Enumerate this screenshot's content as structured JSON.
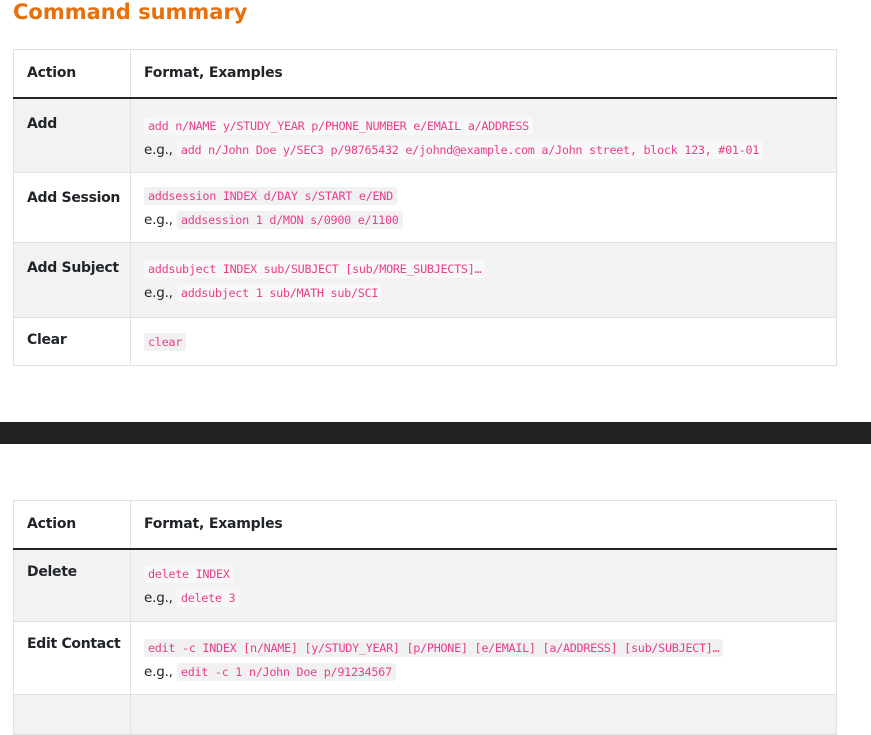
{
  "page": {
    "title": "Command summary",
    "accent_color": "#e76f0c",
    "code_color": "#e83e8c"
  },
  "table1": {
    "headers": {
      "action": "Action",
      "format": "Format, Examples"
    },
    "rows": [
      {
        "action": "Add",
        "format": "add n/NAME y/STUDY_YEAR p/PHONE_NUMBER e/EMAIL a/ADDRESS",
        "eg_prefix": "e.g.,",
        "example": "add n/John Doe y/SEC3 p/98765432 e/johnd@example.com a/John street, block 123, #01-01"
      },
      {
        "action": "Add Session",
        "format": "addsession INDEX d/DAY s/START e/END",
        "eg_prefix": "e.g.,",
        "example": "addsession 1 d/MON s/0900 e/1100"
      },
      {
        "action": "Add Subject",
        "format": "addsubject INDEX sub/SUBJECT [sub/MORE_SUBJECTS]…",
        "eg_prefix": "e.g.,",
        "example": "addsubject 1 sub/MATH sub/SCI"
      },
      {
        "action": "Clear",
        "format": "clear"
      }
    ]
  },
  "table2": {
    "headers": {
      "action": "Action",
      "format": "Format, Examples"
    },
    "rows": [
      {
        "action": "Delete",
        "format": "delete INDEX",
        "eg_prefix": "e.g.,",
        "example": "delete 3"
      },
      {
        "action": "Edit Contact",
        "format": "edit -c INDEX [n/NAME] [y/STUDY_YEAR] [p/PHONE] [e/EMAIL] [a/ADDRESS] [sub/SUBJECT]…",
        "eg_prefix": "e.g.,",
        "example": "edit -c 1 n/John Doe p/91234567"
      }
    ]
  }
}
